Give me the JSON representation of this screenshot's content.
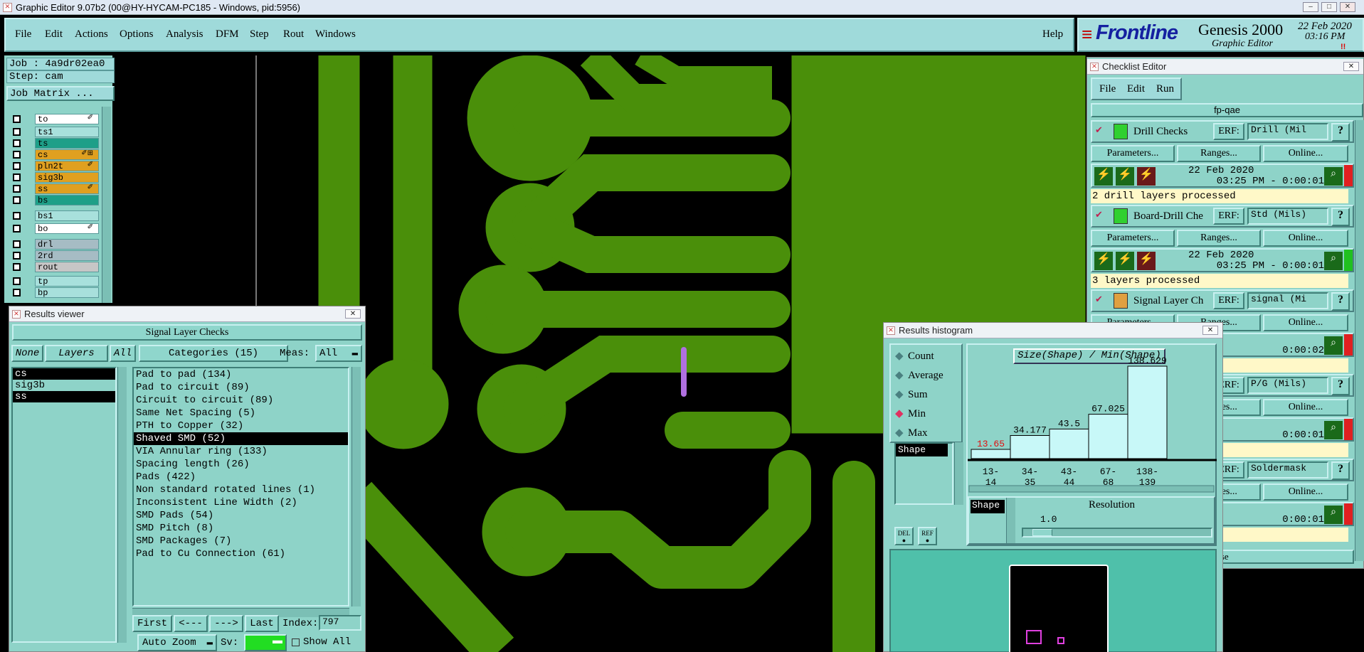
{
  "window": {
    "title": "Graphic Editor 9.07b2 (00@HY-HYCAM-PC185 - Windows, pid:5956)",
    "min": "–",
    "max": "□",
    "close": "✕"
  },
  "menu": {
    "items": [
      "File",
      "Edit",
      "Actions",
      "Options",
      "Analysis",
      "DFM",
      "Step",
      "Rout",
      "Windows"
    ],
    "help": "Help"
  },
  "brand": {
    "logo": "Frontline",
    "product": "Genesis 2000",
    "subtitle": "Graphic Editor",
    "date": "22 Feb 2020",
    "time": "03:16 PM",
    "indicator": "!!"
  },
  "left": {
    "job": "Job : 4a9dr02ea0",
    "step": "Step: cam",
    "job_matrix": "Job Matrix ..."
  },
  "layers": [
    {
      "name": "to",
      "color": "#ffffff",
      "edit": "✐"
    },
    {
      "name": "ts1",
      "color": "#a8e0dc",
      "edit": ""
    },
    {
      "name": "ts",
      "color": "#1e9f88",
      "edit": ""
    },
    {
      "name": "cs",
      "color": "#e0a020",
      "edit": "✐⊞"
    },
    {
      "name": "pln2t",
      "color": "#e0a020",
      "edit": "✐"
    },
    {
      "name": "sig3b",
      "color": "#e0a020",
      "edit": ""
    },
    {
      "name": "ss",
      "color": "#e0a020",
      "edit": "✐"
    },
    {
      "name": "bs",
      "color": "#1e9f88",
      "edit": ""
    },
    {
      "name": "bs1",
      "color": "#a8e0dc",
      "edit": ""
    },
    {
      "name": "bo",
      "color": "#ffffff",
      "edit": "✐"
    },
    {
      "name": "drl",
      "color": "#a6bcc4",
      "edit": ""
    },
    {
      "name": "2rd",
      "color": "#a6bcc4",
      "edit": ""
    },
    {
      "name": "rout",
      "color": "#c6c6c6",
      "edit": ""
    },
    {
      "name": "tp",
      "color": "#a8e0dc",
      "edit": ""
    },
    {
      "name": "bp",
      "color": "#a8e0dc",
      "edit": ""
    }
  ],
  "results_viewer": {
    "title": "Results viewer",
    "heading": "Signal Layer Checks",
    "tabs": {
      "none": "None",
      "layers": "Layers",
      "all": "All"
    },
    "categories_label": "Categories (15)",
    "meas_label": "Meas:",
    "meas_value": "All",
    "layer_list": [
      "cs",
      "sig3b",
      "ss"
    ],
    "categories": [
      "Pad to pad (134)",
      "Pad to circuit (89)",
      "Circuit to circuit (89)",
      "Same Net Spacing (5)",
      "PTH to Copper (32)",
      "Shaved SMD (52)",
      "VIA Annular ring (133)",
      "Spacing length (26)",
      "Pads (422)",
      "Non standard rotated lines (1)",
      "Inconsistent Line Width (2)",
      "SMD Pads (54)",
      "SMD Pitch (8)",
      "SMD Packages (7)",
      "Pad to Cu Connection (61)"
    ],
    "selected_category": "Shaved SMD (52)",
    "nav": {
      "first": "First",
      "prev": "<---",
      "next": "--->",
      "last": "Last",
      "index_label": "Index:",
      "index_value": "797"
    },
    "auto_zoom": "Auto Zoom",
    "sv_label": "Sv:",
    "show_all": "Show All"
  },
  "histogram": {
    "title": "Results histogram",
    "options": [
      "Count",
      "Average",
      "Sum",
      "Min",
      "Max"
    ],
    "selected_option": "Min",
    "list_item": "Shape",
    "chart_title": "Size(Shape) / Min(Shape)",
    "bars": [
      {
        "value": "13.65",
        "range": "13-\n14",
        "level": 0.1,
        "highlight": true
      },
      {
        "value": "34.177",
        "range": "34-\n35",
        "level": 0.25,
        "highlight": false
      },
      {
        "value": "43.5",
        "range": "43-\n44",
        "level": 0.32,
        "highlight": false
      },
      {
        "value": "67.025",
        "range": "67-\n68",
        "level": 0.48,
        "highlight": false
      },
      {
        "value": "138.629",
        "range": "138-\n139",
        "level": 1.0,
        "highlight": false
      }
    ],
    "shape_label": "Shape",
    "resolution_label": "Resolution",
    "resolution_value": "1.0",
    "del": "DEL",
    "ref": "REF"
  },
  "checklist": {
    "title": "Checklist Editor",
    "menu": [
      "File",
      "Edit",
      "Run"
    ],
    "name": "fp-qae",
    "erf": "ERF:",
    "params": "Parameters...",
    "ranges": "Ranges...",
    "online": "Online...",
    "checks": [
      {
        "name": "Drill Checks",
        "erf_value": "Drill (Mil",
        "date": "22 Feb 2020",
        "time": "03:25 PM - 0:00:01",
        "status": "2 drill layers processed",
        "flag": "#e02020"
      },
      {
        "name": "Board-Drill Che",
        "erf_value": "Std (Mils)",
        "date": "22 Feb 2020",
        "time": "03:25 PM - 0:00:01",
        "status": "3 layers processed",
        "flag": "#20c020"
      },
      {
        "name": "Signal Layer Ch",
        "erf_value": "signal (Mi",
        "date": "2020",
        "time": "0:00:02",
        "status": "sed",
        "flag": "#e02020"
      },
      {
        "name": "",
        "erf_value": "P/G (Mils)",
        "date": "2020",
        "time": "0:00:01",
        "status": "s processed",
        "flag": "#e02020"
      },
      {
        "name": "",
        "erf_value": "Soldermask",
        "date": "2020",
        "time": "0:00:01",
        "status": "were processed",
        "flag": "#e02020"
      }
    ],
    "close": "ose"
  }
}
